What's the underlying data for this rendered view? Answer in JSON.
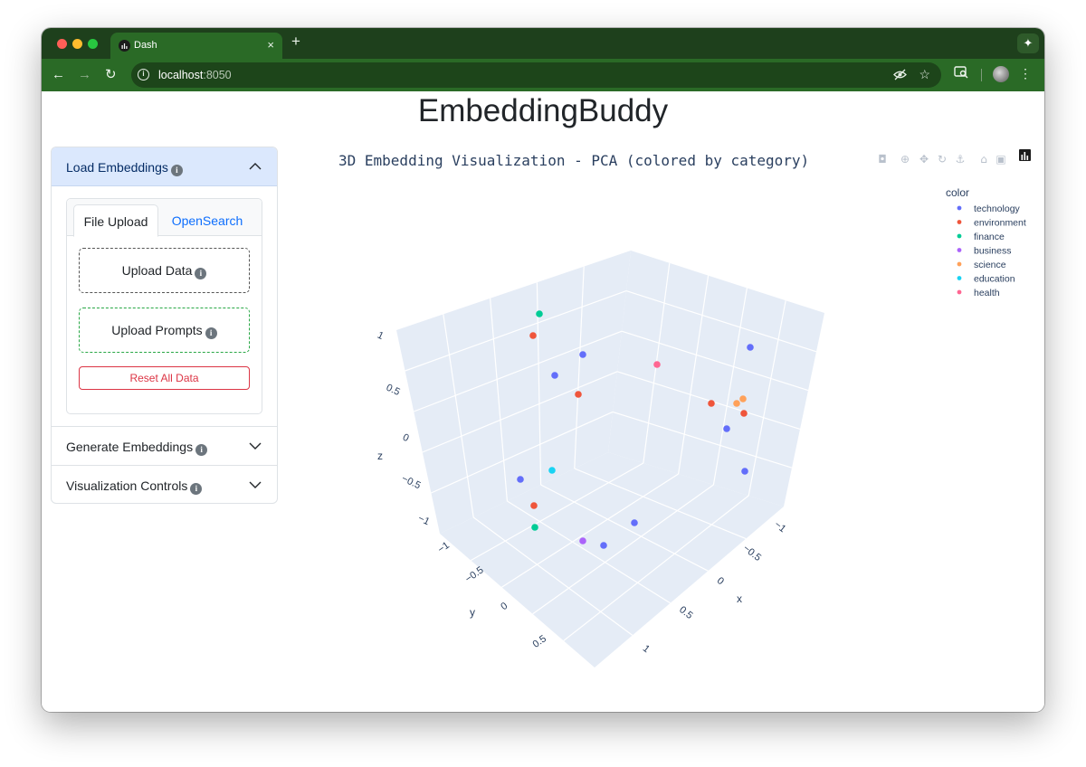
{
  "browser": {
    "tab_title": "Dash",
    "close_glyph": "×",
    "new_tab_glyph": "+",
    "url_host": "localhost",
    "url_port": ":8050",
    "icons": [
      "back-icon",
      "forward-icon",
      "reload-icon",
      "site-info-icon",
      "eye-off-icon",
      "star-icon",
      "tab-search-icon",
      "avatar",
      "menu-icon",
      "gemini-icon"
    ]
  },
  "app": {
    "title": "EmbeddingBuddy"
  },
  "sidebar": {
    "load_embeddings": "Load Embeddings",
    "tabs": {
      "file_upload": "File Upload",
      "opensearch": "OpenSearch"
    },
    "upload_data": "Upload Data",
    "upload_prompts": "Upload Prompts",
    "reset": "Reset All Data",
    "generate_embeddings": "Generate Embeddings",
    "visualization_controls": "Visualization Controls",
    "colors": {
      "active_header_bg": "#dbe8fd",
      "primary": "#0d6efd",
      "danger": "#dc3545",
      "success": "#28a745"
    }
  },
  "chart_data": {
    "type": "scatter",
    "dimensions": 3,
    "title": "3D Embedding Visualization - PCA (colored by category)",
    "xlabel": "x",
    "ylabel": "y",
    "zlabel": "z",
    "x_ticks": [
      "−1",
      "−0.5",
      "0",
      "0.5",
      "1"
    ],
    "y_ticks": [
      "−1",
      "−0.5",
      "0",
      "0.5"
    ],
    "z_ticks": [
      "−1",
      "−0.5",
      "0",
      "0.5",
      "1"
    ],
    "legend_title": "color",
    "legend_position": "top-right",
    "series": [
      {
        "name": "technology",
        "color": "#636efa"
      },
      {
        "name": "environment",
        "color": "#ef553b"
      },
      {
        "name": "finance",
        "color": "#00cc96"
      },
      {
        "name": "business",
        "color": "#ab63fa"
      },
      {
        "name": "science",
        "color": "#ffa15a"
      },
      {
        "name": "education",
        "color": "#19d3f3"
      },
      {
        "name": "health",
        "color": "#ff6692"
      }
    ],
    "points": [
      {
        "series": "finance",
        "sx": 596,
        "sy": 347
      },
      {
        "series": "environment",
        "sx": 589,
        "sy": 371
      },
      {
        "series": "technology",
        "sx": 644,
        "sy": 392
      },
      {
        "series": "technology",
        "sx": 613,
        "sy": 415
      },
      {
        "series": "environment",
        "sx": 639,
        "sy": 436
      },
      {
        "series": "health",
        "sx": 726,
        "sy": 403
      },
      {
        "series": "technology",
        "sx": 829,
        "sy": 384
      },
      {
        "series": "environment",
        "sx": 786,
        "sy": 446
      },
      {
        "series": "science",
        "sx": 814,
        "sy": 446
      },
      {
        "series": "science",
        "sx": 821,
        "sy": 441
      },
      {
        "series": "environment",
        "sx": 822,
        "sy": 457
      },
      {
        "series": "technology",
        "sx": 803,
        "sy": 474
      },
      {
        "series": "technology",
        "sx": 823,
        "sy": 521
      },
      {
        "series": "education",
        "sx": 610,
        "sy": 520
      },
      {
        "series": "technology",
        "sx": 575,
        "sy": 530
      },
      {
        "series": "environment",
        "sx": 590,
        "sy": 559
      },
      {
        "series": "finance",
        "sx": 591,
        "sy": 583
      },
      {
        "series": "technology",
        "sx": 701,
        "sy": 578
      },
      {
        "series": "business",
        "sx": 644,
        "sy": 598
      },
      {
        "series": "technology",
        "sx": 667,
        "sy": 603
      }
    ],
    "modebar_icons": [
      "camera-icon",
      "zoom-icon",
      "pan-icon",
      "orbit-icon",
      "turntable-icon",
      "reset-home-icon",
      "reset-view-icon",
      "plotly-logo-icon"
    ]
  }
}
